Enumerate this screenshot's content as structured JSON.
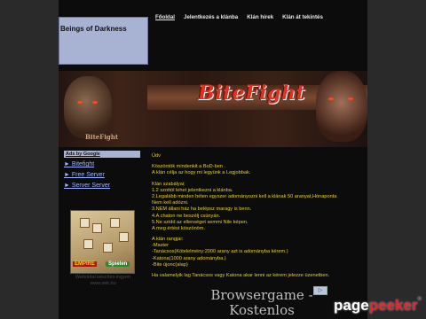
{
  "site": {
    "title": "Beings of Darkness"
  },
  "nav": [
    {
      "label": "Főoldal",
      "active": true
    },
    {
      "label": "Jelentkezés a klánba"
    },
    {
      "label": "Klán hírek"
    },
    {
      "label": "Klán át tekintés"
    }
  ],
  "banner": {
    "brand": "BiteFight",
    "brand_small": "BiteFight"
  },
  "sidebar": {
    "ads_title": "Ads by Google",
    "links": [
      "► Bitefight",
      "► Free Server",
      "► Server Server"
    ],
    "game_ad": {
      "brand": "EMPIRE",
      "play": "Spielen"
    },
    "credit": "Weboldal készítés ingyen www.sek.hu"
  },
  "content": {
    "lines": [
      "Üdv",
      "",
      "Köszöntök mindenkit a BoD-ben .",
      "A klán célja az hogy mi legyünk a Legjobbak.",
      "",
      "Klán szabályai:",
      "1.2 szottól lehet jelentkezni a klánba.",
      "2.Legalább minden héten egyszer adományozni kell a klának 50 aranyat,Hónaponta",
      "Nem kell adózni.",
      "3.NEM állani ház ha belépsz maragy is benn.",
      "4.A chaton ne beszélj csúnyán.",
      "5.Ne szidd az ellenséget semmi Nile képen.",
      "A meg értést köszönöm.",
      "",
      "A klán rangjai:",
      "-Master",
      "-Tanácsos(Kötelelmény:2000 arany azt is adományba kérem.)",
      "-Katona(1000 arany adományba.)",
      "-Bite újonc(alap)",
      "",
      "Ha valamelyik lag Tanácsos vagy Katona akar lenni az kérem jelezze üzenetben."
    ]
  },
  "bottom_ad": {
    "line1": "Browsergame -",
    "line2": "Kostenlos"
  },
  "watermark": {
    "page": "page",
    "peeker": "peeker",
    "reg": "®"
  },
  "colors": {
    "background": "#2a2a2a",
    "frame": "#0c0c0c",
    "accent_box": "#a8b3d3",
    "content_text": "#e6d21a",
    "link": "#9fb5ff"
  }
}
